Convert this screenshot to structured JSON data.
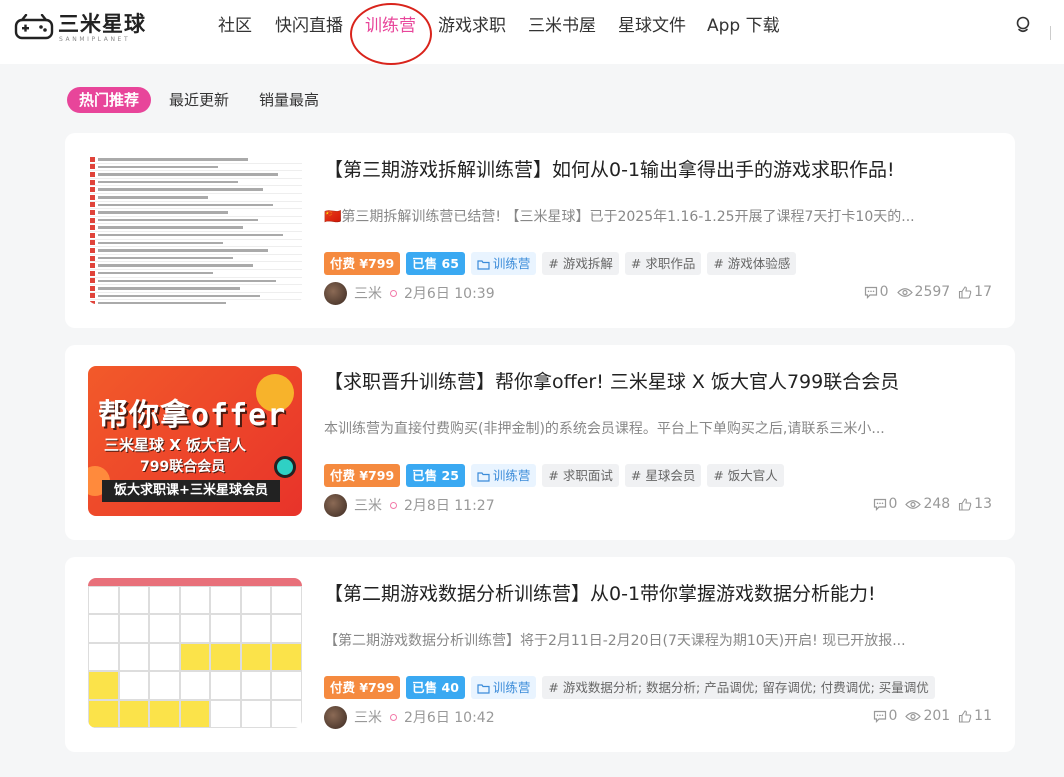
{
  "header": {
    "logo_name": "三米星球",
    "logo_sub": "SANMIPLANET",
    "nav": [
      "社区",
      "快闪直播",
      "训练营",
      "游戏求职",
      "三米书屋",
      "星球文件",
      "App 下载"
    ],
    "active_nav": "训练营"
  },
  "tabs": [
    "热门推荐",
    "最近更新",
    "销量最高"
  ],
  "cards": [
    {
      "title": "【第三期游戏拆解训练营】如何从0-1输出拿得出手的游戏求职作品!",
      "desc": "🇨🇳第三期拆解训练营已结营! 【三米星球】已于2025年1.16-1.25开展了课程7天打卡10天的...",
      "price": "付费 ¥799",
      "sold": "已售 65",
      "category": "训练营",
      "topics": [
        "# 游戏拆解",
        "# 求职作品",
        "# 游戏体验感"
      ],
      "author": "三米",
      "time": "2月6日 10:39",
      "comments": "0",
      "views": "2597",
      "likes": "17"
    },
    {
      "title": "【求职晋升训练营】帮你拿offer! 三米星球 X 饭大官人799联合会员",
      "desc": "本训练营为直接付费购买(非押金制)的系统会员课程。平台上下单购买之后,请联系三米小...",
      "price": "付费 ¥799",
      "sold": "已售 25",
      "category": "训练营",
      "topics": [
        "# 求职面试",
        "# 星球会员",
        "# 饭大官人"
      ],
      "author": "三米",
      "time": "2月8日 11:27",
      "comments": "0",
      "views": "248",
      "likes": "13",
      "banner": {
        "big": "帮你拿offer",
        "mid": "三米星球 X 饭大官人",
        "mid2": "799联合会员",
        "bar": "饭大求职课+三米星球会员"
      }
    },
    {
      "title": "【第二期游戏数据分析训练营】从0-1带你掌握游戏数据分析能力!",
      "desc": "【第二期游戏数据分析训练营】将于2月11日-2月20日(7天课程为期10天)开启! 现已开放报...",
      "price": "付费 ¥799",
      "sold": "已售 40",
      "category": "训练营",
      "topics": [
        "# 游戏数据分析; 数据分析; 产品调优; 留存调优; 付费调优; 买量调优"
      ],
      "author": "三米",
      "time": "2月6日 10:42",
      "comments": "0",
      "views": "201",
      "likes": "11"
    }
  ],
  "colors": {
    "accent": "#e8459a",
    "price": "#f58a3f",
    "sold": "#3aa9f2",
    "annotation_circle": "#d9241c"
  }
}
